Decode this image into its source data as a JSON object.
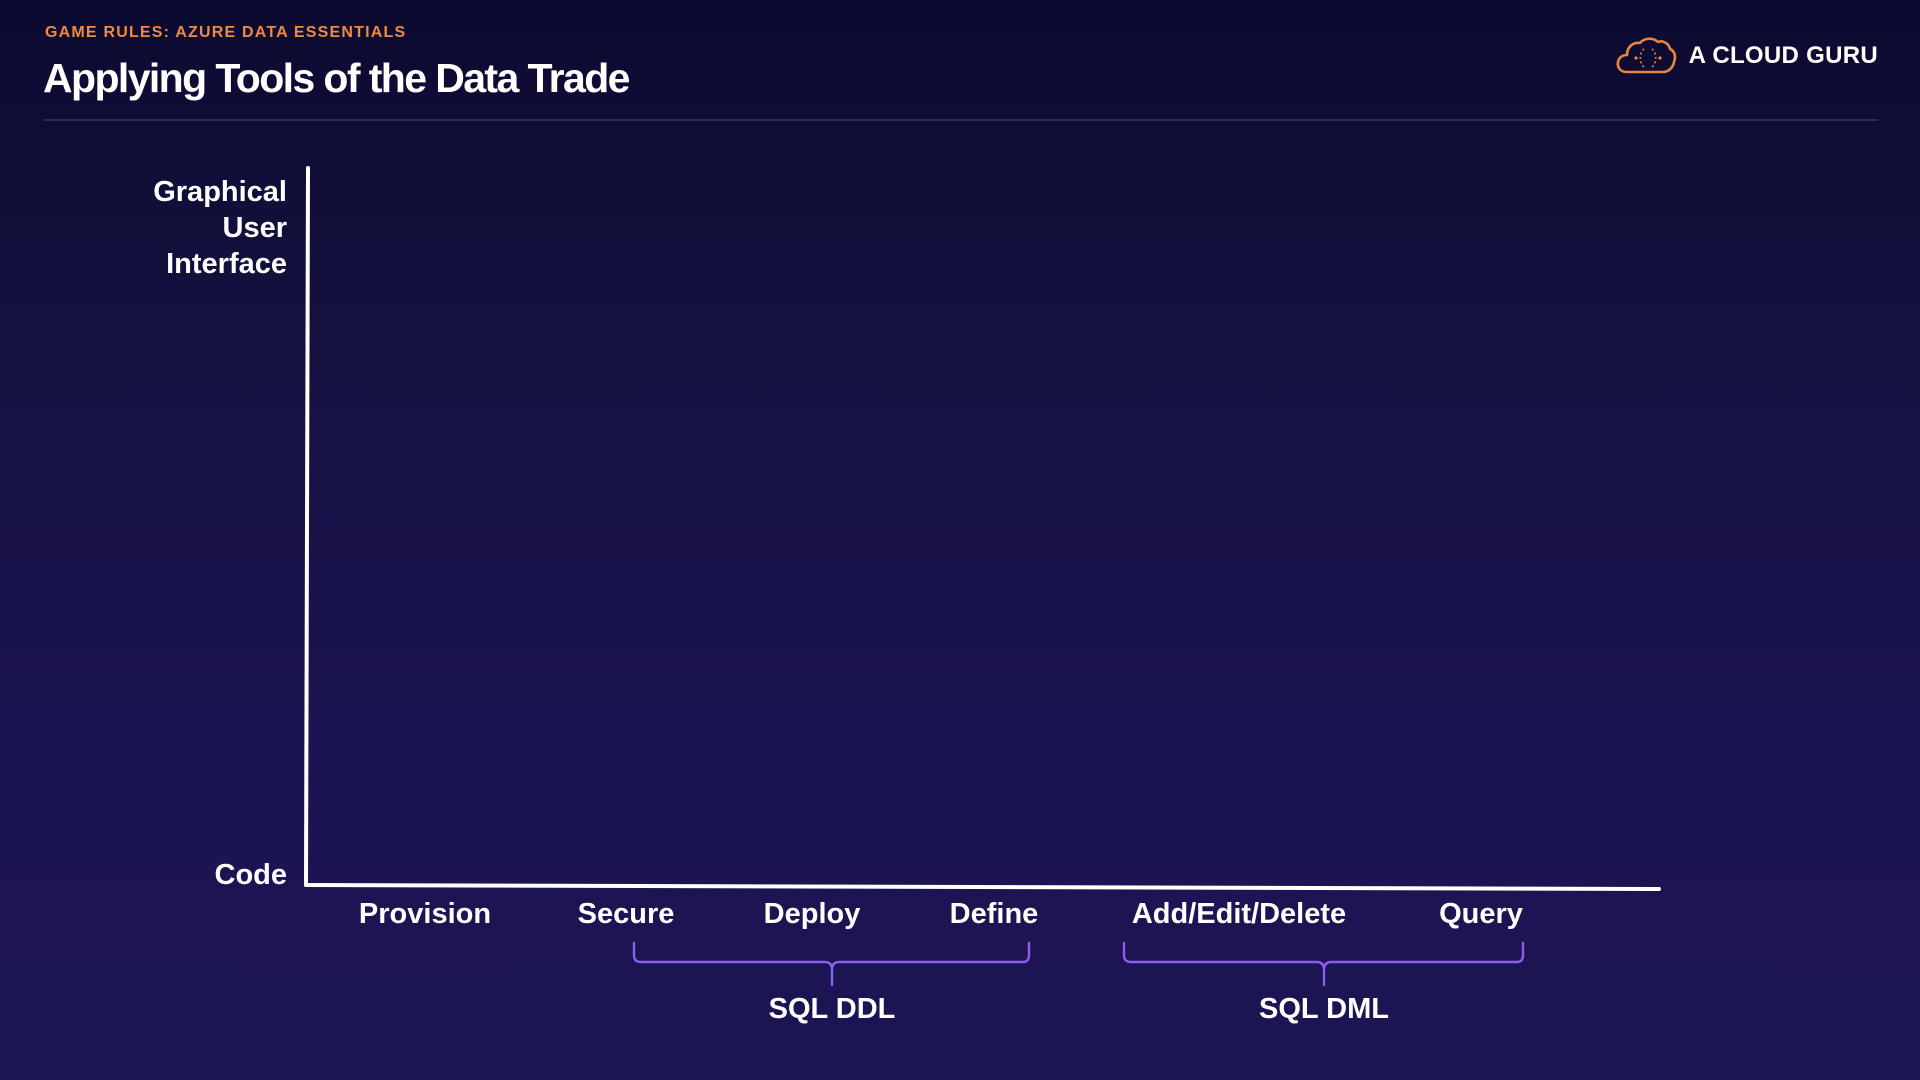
{
  "header": {
    "eyebrow": "GAME RULES: AZURE DATA ESSENTIALS",
    "title": "Applying Tools of the Data Trade",
    "brand_name": "A CLOUD GURU",
    "brand_icon": "cloud-icon"
  },
  "diagram": {
    "y_axis": {
      "top_label_lines": [
        "Graphical",
        "User",
        "Interface"
      ],
      "bottom_label": "Code"
    },
    "x_axis": {
      "stages": [
        "Provision",
        "Secure",
        "Deploy",
        "Define",
        "Add/Edit/Delete",
        "Query"
      ]
    },
    "groups": [
      {
        "label": "SQL DDL",
        "from": "Secure",
        "to": "Define"
      },
      {
        "label": "SQL DML",
        "from": "Add/Edit/Delete",
        "to": "Query"
      }
    ]
  },
  "colors": {
    "background_top": "#0c0a30",
    "background_bottom": "#1c1554",
    "eyebrow": "#f08a3c",
    "brand_logo": "#e9863b",
    "axis": "#ffffff",
    "bracket": "#8d5cf0"
  }
}
